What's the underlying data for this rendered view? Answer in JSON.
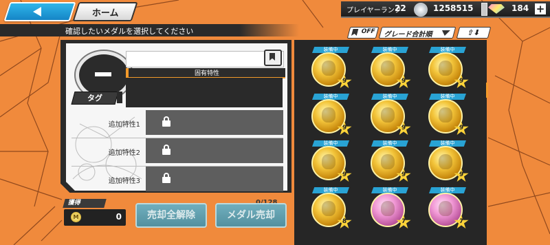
{
  "header": {
    "home_label": "ホーム",
    "player_rank_label": "プレイヤーランク",
    "player_rank": "22",
    "coins": "1258515",
    "gems": "184",
    "add_label": "+"
  },
  "instruction": "確認したいメダルを選択してください",
  "controls": {
    "favorite_filter": "OFF",
    "sort_label": "グレード合計順",
    "order_label": "⇧⬇"
  },
  "detail": {
    "unique_trait_label": "固有特性",
    "tag_label": "タグ",
    "additional_traits": [
      {
        "label": "追加特性1"
      },
      {
        "label": "追加特性2"
      },
      {
        "label": "追加特性3"
      }
    ]
  },
  "footer": {
    "obtain_label": "獲得",
    "coin_letter": "M",
    "obtain_value": "0",
    "count": "0/128",
    "cancel_all_label": "売却全解除",
    "sell_label": "メダル売却"
  },
  "medals": [
    {
      "tag": "装備中",
      "grade": "9",
      "color": "gold"
    },
    {
      "tag": "装備中",
      "grade": "9",
      "color": "gold"
    },
    {
      "tag": "装備中",
      "grade": "9",
      "color": "gold"
    },
    {
      "tag": "装備中",
      "grade": "9",
      "color": "gold"
    },
    {
      "tag": "装備中",
      "grade": "9",
      "color": "gold"
    },
    {
      "tag": "装備中",
      "grade": "9",
      "color": "gold"
    },
    {
      "tag": "装備中",
      "grade": "9",
      "color": "gold"
    },
    {
      "tag": "装備中",
      "grade": "9",
      "color": "gold"
    },
    {
      "tag": "装備中",
      "grade": "9",
      "color": "gold"
    },
    {
      "tag": "装備中",
      "grade": "8",
      "color": "gold"
    },
    {
      "tag": "装備中",
      "grade": "7",
      "color": "pink"
    },
    {
      "tag": "装備中",
      "grade": "7",
      "color": "pink"
    }
  ],
  "colors": {
    "accent_blue": "#29a3d4",
    "accent_orange": "#f39a2a",
    "background": "#f08a3c"
  }
}
